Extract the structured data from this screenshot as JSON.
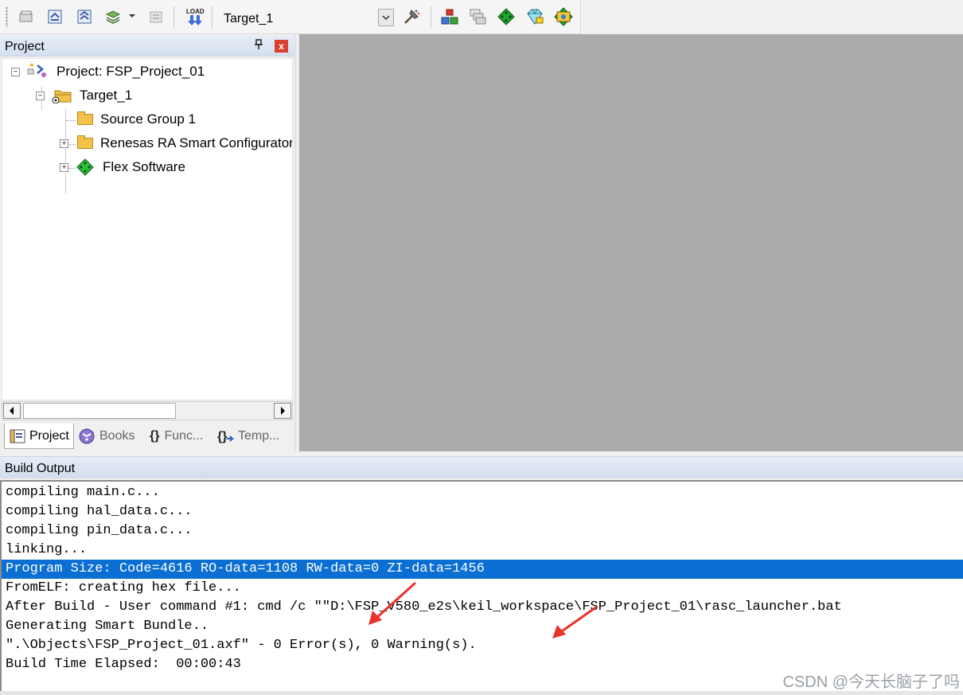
{
  "toolbar": {
    "items": [
      {
        "name": "batch-build-icon"
      },
      {
        "name": "translate-icon"
      },
      {
        "name": "build-icon"
      },
      {
        "name": "rebuild-icon"
      },
      {
        "name": "stop-build-icon"
      },
      {
        "name": "load-icon",
        "label": "LOAD"
      },
      {
        "name": "options-for-target-icon"
      },
      {
        "name": "manage-project-items-icon"
      },
      {
        "name": "file-extensions-icon"
      },
      {
        "name": "pack-installer-icon"
      },
      {
        "name": "select-software-packs-icon"
      },
      {
        "name": "run-time-environment-icon"
      }
    ],
    "target_value": "Target_1"
  },
  "project_panel": {
    "title": "Project",
    "pin_glyph": "†",
    "close_glyph": "x",
    "tree": {
      "root": "Project: FSP_Project_01",
      "target": "Target_1",
      "items": [
        {
          "label": "Source Group 1",
          "icon": "folder-icon",
          "expandable": false
        },
        {
          "label": "Renesas RA Smart Configurator",
          "icon": "folder-icon",
          "expandable": true
        },
        {
          "label": "Flex Software",
          "icon": "component-diamond-icon",
          "expandable": true
        }
      ]
    },
    "tabs": [
      {
        "label": "Project",
        "active": true
      },
      {
        "label": "Books",
        "active": false
      },
      {
        "label": "Func...",
        "active": false
      },
      {
        "label": "Temp...",
        "active": false
      }
    ]
  },
  "build_output": {
    "title": "Build Output",
    "lines": [
      "compiling main.c...",
      "compiling hal_data.c...",
      "compiling pin_data.c...",
      "linking...",
      "Program Size: Code=4616 RO-data=1108 RW-data=0 ZI-data=1456",
      "FromELF: creating hex file...",
      "After Build - User command #1: cmd /c \"\"D:\\FSP_V580_e2s\\keil_workspace\\FSP_Project_01\\rasc_launcher.bat",
      "Generating Smart Bundle..",
      "\".\\Objects\\FSP_Project_01.axf\" - 0 Error(s), 0 Warning(s).",
      "Build Time Elapsed:  00:00:43"
    ],
    "highlighted_line_index": 4
  },
  "watermark": "CSDN @今天长脑子了吗",
  "colors": {
    "selection": "#0a6ed2",
    "workspace": "#ababab",
    "annotation_arrow": "#e8322a"
  }
}
